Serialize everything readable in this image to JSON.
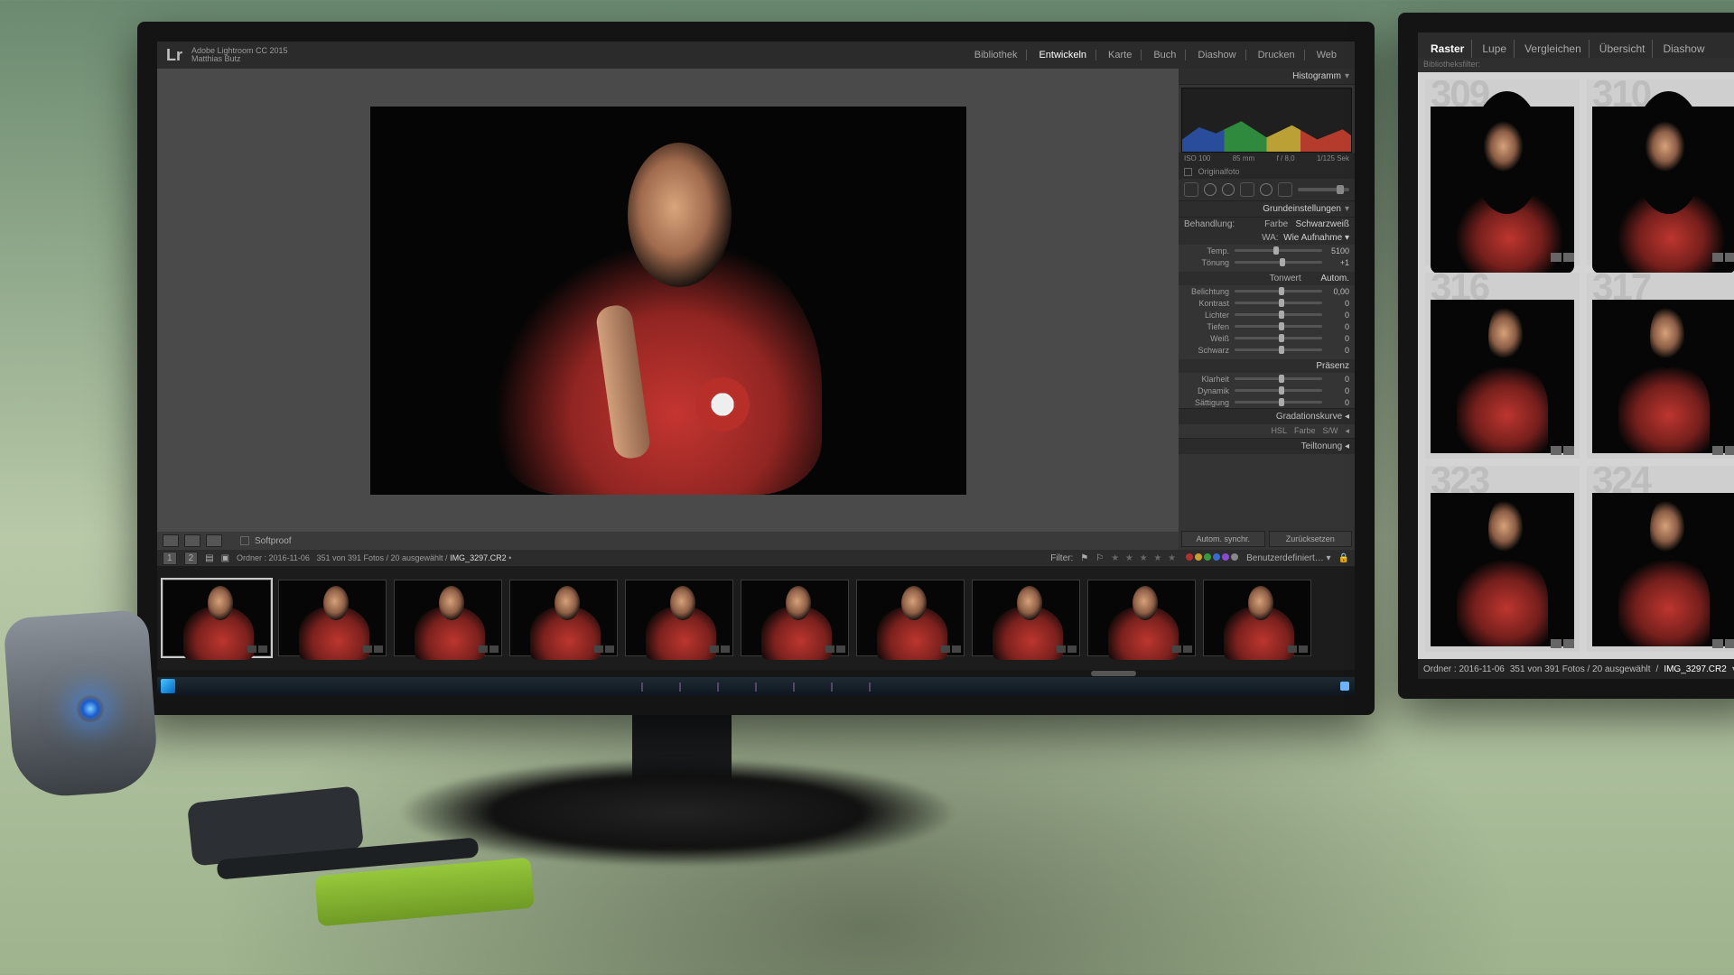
{
  "app": {
    "suite": "Adobe Lightroom CC 2015",
    "user": "Matthias Butz",
    "logo": "Lr"
  },
  "modules": {
    "items": [
      "Bibliothek",
      "Entwickeln",
      "Karte",
      "Buch",
      "Diashow",
      "Drucken",
      "Web"
    ],
    "active_index": 1
  },
  "view_toolbar": {
    "softproof_label": "Softproof",
    "softproof_checked": false
  },
  "info_bar": {
    "grid_mode": "1",
    "alt_mode": "2",
    "folder_text": "Ordner : 2016-11-06",
    "count_text": "351 von 391 Fotos / 20 ausgewählt",
    "filename": "IMG_3297.CR2",
    "modified_flag": "•",
    "filter_label": "Filter:",
    "filter_preset": "Benutzerdefiniert…"
  },
  "panel": {
    "histogram_title": "Histogramm",
    "histogram_info": {
      "iso": "ISO 100",
      "focal": "85 mm",
      "aperture": "f / 8,0",
      "shutter": "1/125 Sek"
    },
    "original_label": "Originalfoto",
    "basic_title": "Grundeinstellungen",
    "treatment": {
      "label": "Behandlung:",
      "color": "Farbe",
      "bw": "Schwarzweiß"
    },
    "wb": {
      "label": "WA:",
      "mode": "Wie Aufnahme"
    },
    "sliders_wb": [
      {
        "lab": "Temp.",
        "val": "5100",
        "pos": 44
      },
      {
        "lab": "Tönung",
        "val": "+1",
        "pos": 52
      }
    ],
    "tone_header": {
      "lab": "Tonwert",
      "auto": "Autom."
    },
    "sliders_tone": [
      {
        "lab": "Belichtung",
        "val": "0,00",
        "pos": 50
      },
      {
        "lab": "Kontrast",
        "val": "0",
        "pos": 50
      },
      {
        "lab": "Lichter",
        "val": "0",
        "pos": 50
      },
      {
        "lab": "Tiefen",
        "val": "0",
        "pos": 50
      },
      {
        "lab": "Weiß",
        "val": "0",
        "pos": 50
      },
      {
        "lab": "Schwarz",
        "val": "0",
        "pos": 50
      }
    ],
    "presence_header": "Präsenz",
    "sliders_presence": [
      {
        "lab": "Klarheit",
        "val": "0",
        "pos": 50
      },
      {
        "lab": "Dynamik",
        "val": "0",
        "pos": 50
      },
      {
        "lab": "Sättigung",
        "val": "0",
        "pos": 50
      }
    ],
    "curve_title": "Gradationskurve",
    "hsl": {
      "hsl": "HSL",
      "color": "Farbe",
      "bw": "S/W"
    },
    "split_title": "Teiltonung",
    "sync": {
      "auto": "Autom. synchr.",
      "reset": "Zurücksetzen"
    }
  },
  "filmstrip": {
    "count": 10,
    "selected_index": 0
  },
  "monitor2": {
    "tabs": [
      "Raster",
      "Lupe",
      "Vergleichen",
      "Übersicht",
      "Diashow"
    ],
    "active_index": 0,
    "lib_filter": "Bibliotheksfilter:",
    "cells": [
      {
        "num": "309",
        "variant": "closeup"
      },
      {
        "num": "310",
        "variant": "closeup"
      },
      {
        "num": "316",
        "variant": "full"
      },
      {
        "num": "317",
        "variant": "full"
      },
      {
        "num": "323",
        "variant": "full"
      },
      {
        "num": "324",
        "variant": "full"
      }
    ],
    "status": {
      "folder_text": "Ordner : 2016-11-06",
      "count_text": "351 von 391 Fotos / 20 ausgewählt",
      "filename": "IMG_3297.CR2"
    }
  },
  "colors": {
    "dot_palette": [
      "#b03030",
      "#c9a030",
      "#3a9a3a",
      "#3a6ad0",
      "#8a4ad0",
      "#888888"
    ]
  }
}
